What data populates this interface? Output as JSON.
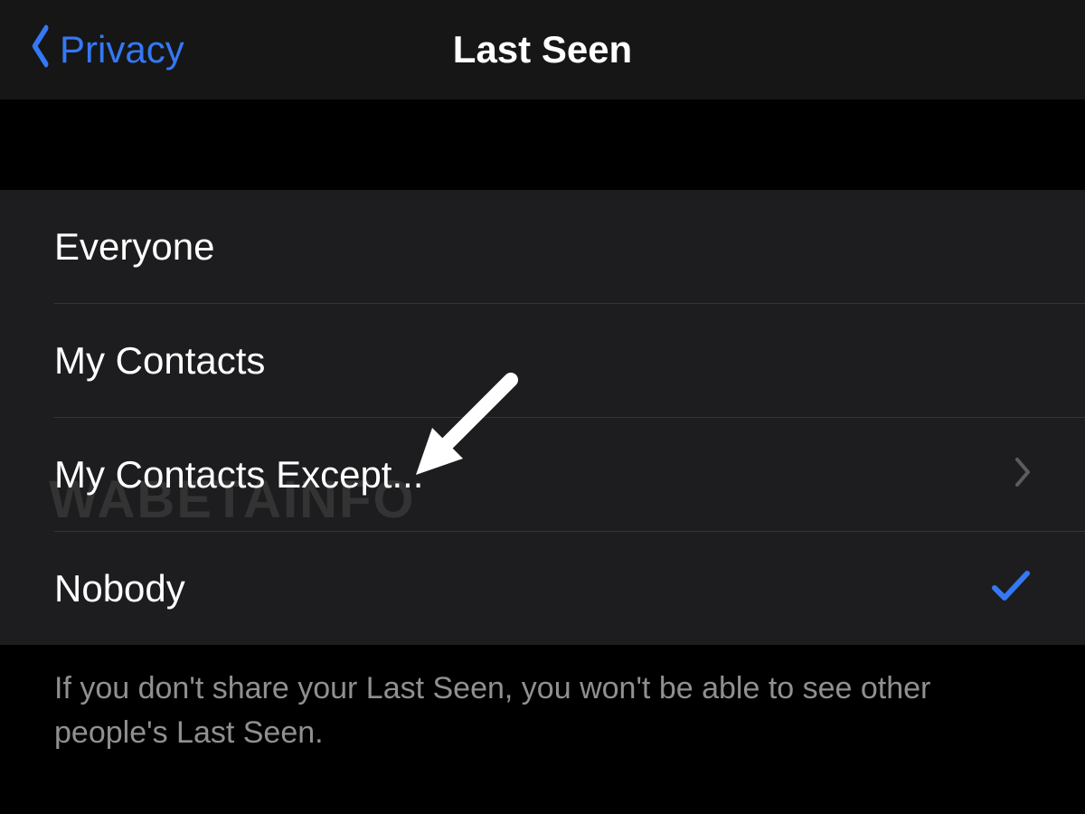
{
  "header": {
    "back_label": "Privacy",
    "title": "Last Seen"
  },
  "options": [
    {
      "label": "Everyone",
      "selected": false,
      "disclosure": false
    },
    {
      "label": "My Contacts",
      "selected": false,
      "disclosure": false
    },
    {
      "label": "My Contacts Except...",
      "selected": false,
      "disclosure": true
    },
    {
      "label": "Nobody",
      "selected": true,
      "disclosure": false
    }
  ],
  "footer": "If you don't share your Last Seen, you won't be able to see other people's Last Seen.",
  "watermark": "WABETAINFO"
}
